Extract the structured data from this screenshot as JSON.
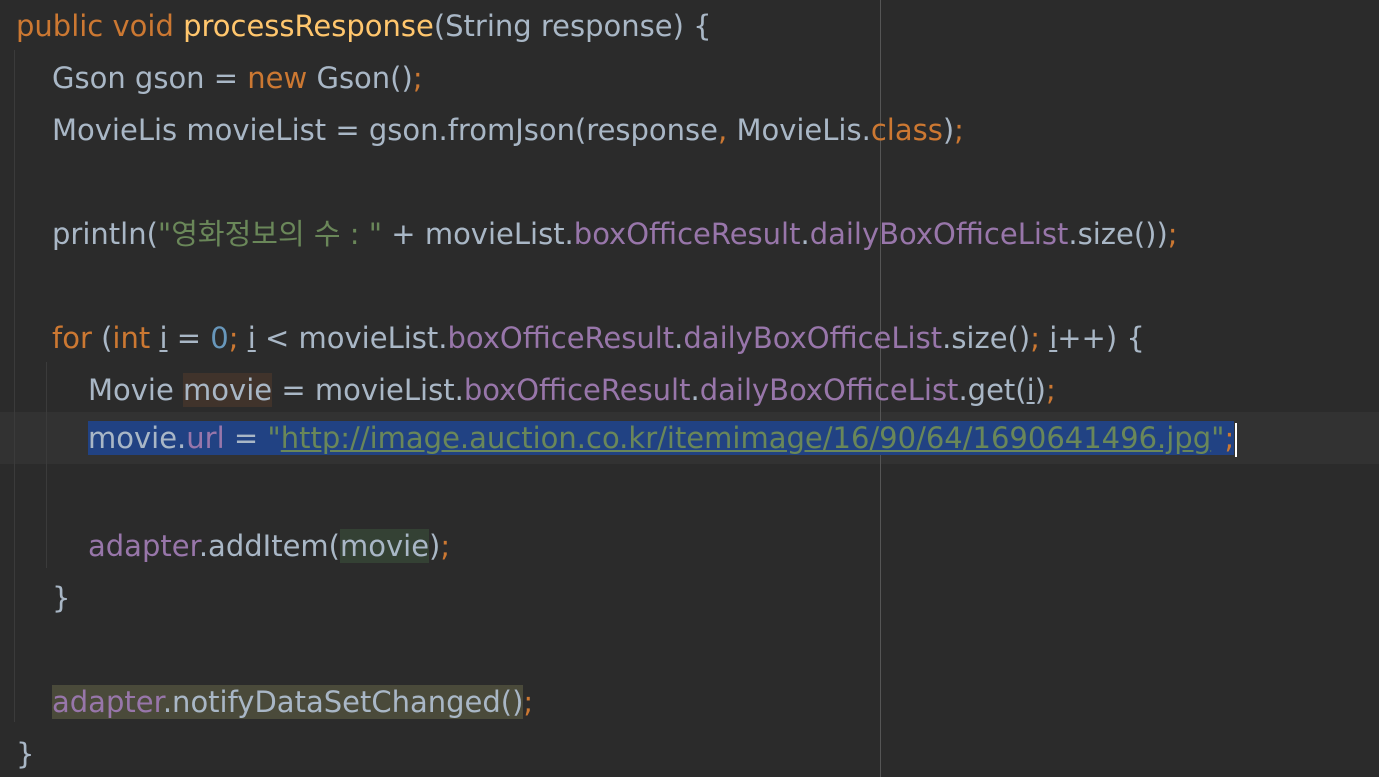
{
  "editor": {
    "colors": {
      "background": "#2b2b2b",
      "keyword": "#cc7832",
      "method_decl": "#ffc66d",
      "number": "#6897bb",
      "string": "#6a8759",
      "field": "#9876aa",
      "default_text": "#a9b7c6",
      "selection": "#214283"
    },
    "lines": {
      "l1": {
        "kw_public": "public",
        "kw_void": "void",
        "method_name": "processResponse",
        "params": "(String response) {"
      },
      "l2": {
        "decl": "Gson gson = ",
        "kw_new": "new",
        "call": " Gson()",
        "semicolon": ";"
      },
      "l3": {
        "decl": "MovieLis movieList = gson.fromJson(response",
        "comma": ",",
        "type_ref": " MovieLis.",
        "kw_class": "class",
        "close": ")",
        "semicolon": ";"
      },
      "l5": {
        "call_open": "println(",
        "string": "\"영화정보의 수 : \"",
        "concat": " + movieList.",
        "field1": "boxOfficeResult",
        "dot": ".",
        "field2": "dailyBoxOfficeList",
        "tail": ".size())",
        "semicolon": ";"
      },
      "l7": {
        "kw_for": "for",
        "paren_open": " (",
        "kw_int": "int",
        "space": " ",
        "var_i": "i",
        "assign": " = ",
        "zero": "0",
        "semi1": ";",
        "space2": " ",
        "var_i2": "i",
        "cond": " < movieList.",
        "field1": "boxOfficeResult",
        "dot": ".",
        "field2": "dailyBoxOfficeList",
        "size": ".size()",
        "semi2": ";",
        "space3": " ",
        "var_i3": "i",
        "incr": "++) {"
      },
      "l8": {
        "type": "Movie ",
        "var": "movie",
        "assign": " = movieList.",
        "field1": "boxOfficeResult",
        "dot": ".",
        "field2": "dailyBoxOfficeList",
        "get_open": ".get(",
        "var_i": "i",
        "get_close": ")",
        "semicolon": ";"
      },
      "l9": {
        "obj": "movie.",
        "field": "url",
        "assign": " = ",
        "quote_open": "\"",
        "url": "http://image.auction.co.kr/itemimage/16/90/64/1690641496.jpg",
        "quote_close": "\"",
        "semicolon": ";"
      },
      "l11": {
        "field": "adapter",
        "call": ".addItem(",
        "arg": "movie",
        "close": ")",
        "semicolon": ";"
      },
      "l12": {
        "brace": "}"
      },
      "l14": {
        "field": "adapter",
        "call": ".notifyDataSetChanged()",
        "semicolon": ";"
      },
      "l15": {
        "brace": "}"
      }
    }
  }
}
